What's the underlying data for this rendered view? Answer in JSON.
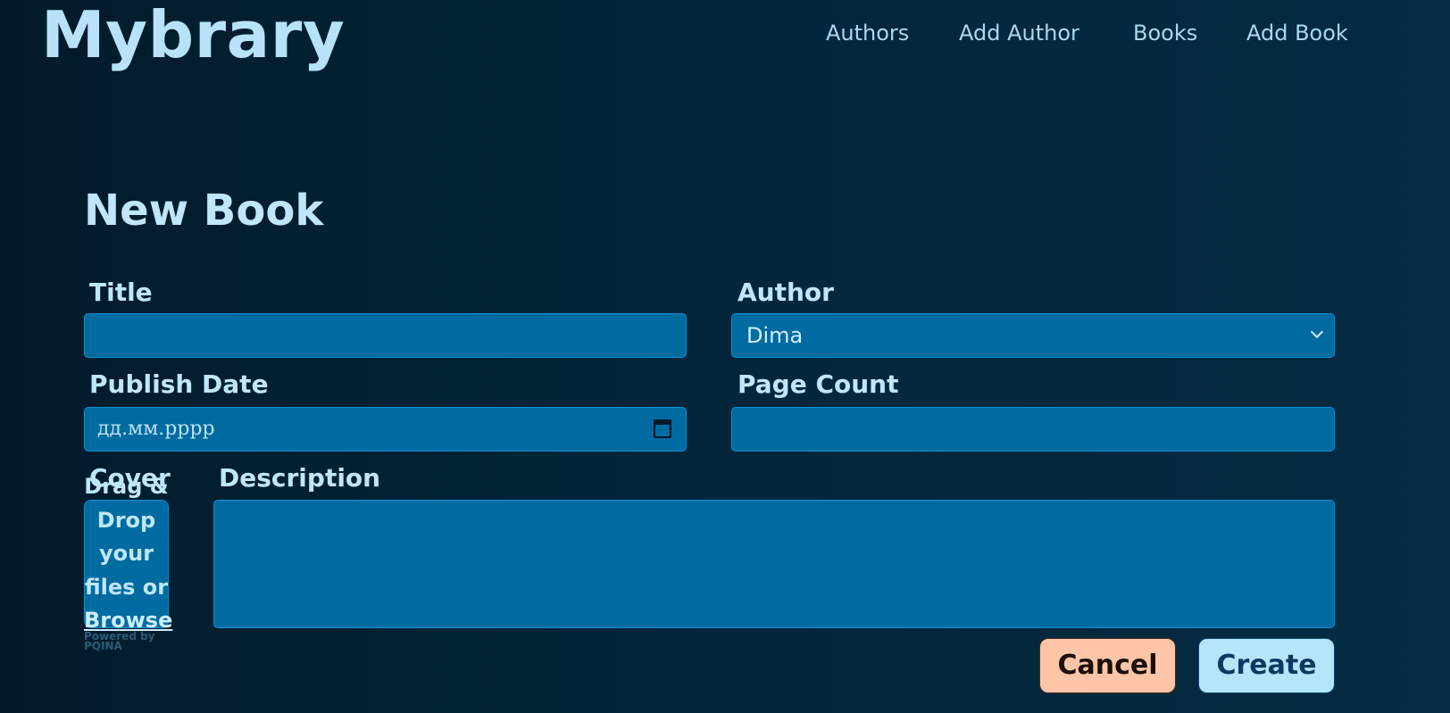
{
  "header": {
    "logo": "Mybrary",
    "nav": [
      {
        "label": "Authors"
      },
      {
        "label": "Add Author"
      },
      {
        "label": "Books"
      },
      {
        "label": "Add Book"
      }
    ]
  },
  "page": {
    "title": "New Book"
  },
  "form": {
    "title_label": "Title",
    "title_value": "",
    "author_label": "Author",
    "author_selected": "Dima",
    "publish_date_label": "Publish Date",
    "publish_date_placeholder": "дд.мм.рррр",
    "page_count_label": "Page Count",
    "page_count_value": "",
    "cover_label": "Cover",
    "cover_drop_lines": [
      "Drag &",
      "Drop",
      "your",
      "files or"
    ],
    "cover_browse": "Browse",
    "powered_by": [
      "Powered by",
      "PQINA"
    ],
    "description_label": "Description",
    "description_value": ""
  },
  "actions": {
    "cancel": "Cancel",
    "create": "Create"
  },
  "colors": {
    "background": "#03263b",
    "field": "#006ba0",
    "field_border": "#0b8fd4",
    "text": "#bfe6fb",
    "cancel_bg": "#ffc5a8",
    "create_bg": "#b5e4fb"
  }
}
